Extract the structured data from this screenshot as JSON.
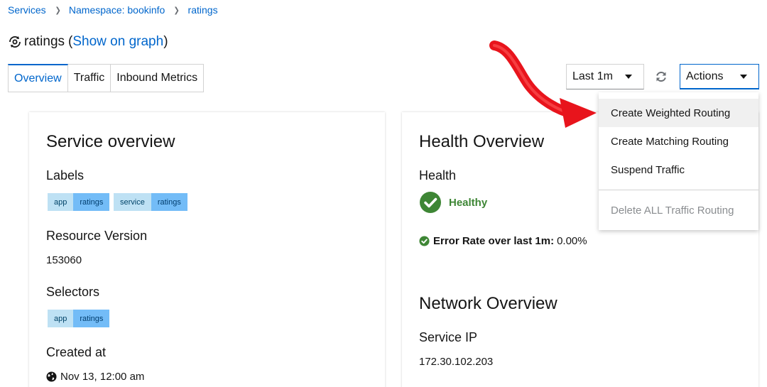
{
  "breadcrumb": {
    "items": [
      "Services",
      "Namespace: bookinfo",
      "ratings"
    ]
  },
  "header": {
    "service_name": "ratings",
    "open_paren": "(",
    "graph_link": "Show on graph",
    "close_paren": ")"
  },
  "tabs": [
    "Overview",
    "Traffic",
    "Inbound Metrics"
  ],
  "toolbar": {
    "time_range": "Last 1m",
    "actions_label": "Actions"
  },
  "actions_menu": {
    "items": [
      "Create Weighted Routing",
      "Create Matching Routing",
      "Suspend Traffic"
    ],
    "danger_item": "Delete ALL Traffic Routing"
  },
  "service_overview": {
    "title": "Service overview",
    "labels_heading": "Labels",
    "labels": [
      {
        "key": "app",
        "value": "ratings"
      },
      {
        "key": "service",
        "value": "ratings"
      }
    ],
    "resource_version_heading": "Resource Version",
    "resource_version": "153060",
    "selectors_heading": "Selectors",
    "selectors": [
      {
        "key": "app",
        "value": "ratings"
      }
    ],
    "created_heading": "Created at",
    "created_value": "Nov 13, 12:00 am"
  },
  "health_overview": {
    "title": "Health Overview",
    "health_heading": "Health",
    "status": "Healthy",
    "error_rate_label": "Error Rate over last 1m:",
    "error_rate_value": "0.00%"
  },
  "network_overview": {
    "title": "Network Overview",
    "service_ip_heading": "Service IP",
    "service_ip": "172.30.102.203"
  },
  "colors": {
    "link": "#0066cc",
    "healthy": "#3e8635",
    "arrow": "#e8141c",
    "label_key_bg": "#bee1f4",
    "label_value_bg": "#73bcf7"
  }
}
